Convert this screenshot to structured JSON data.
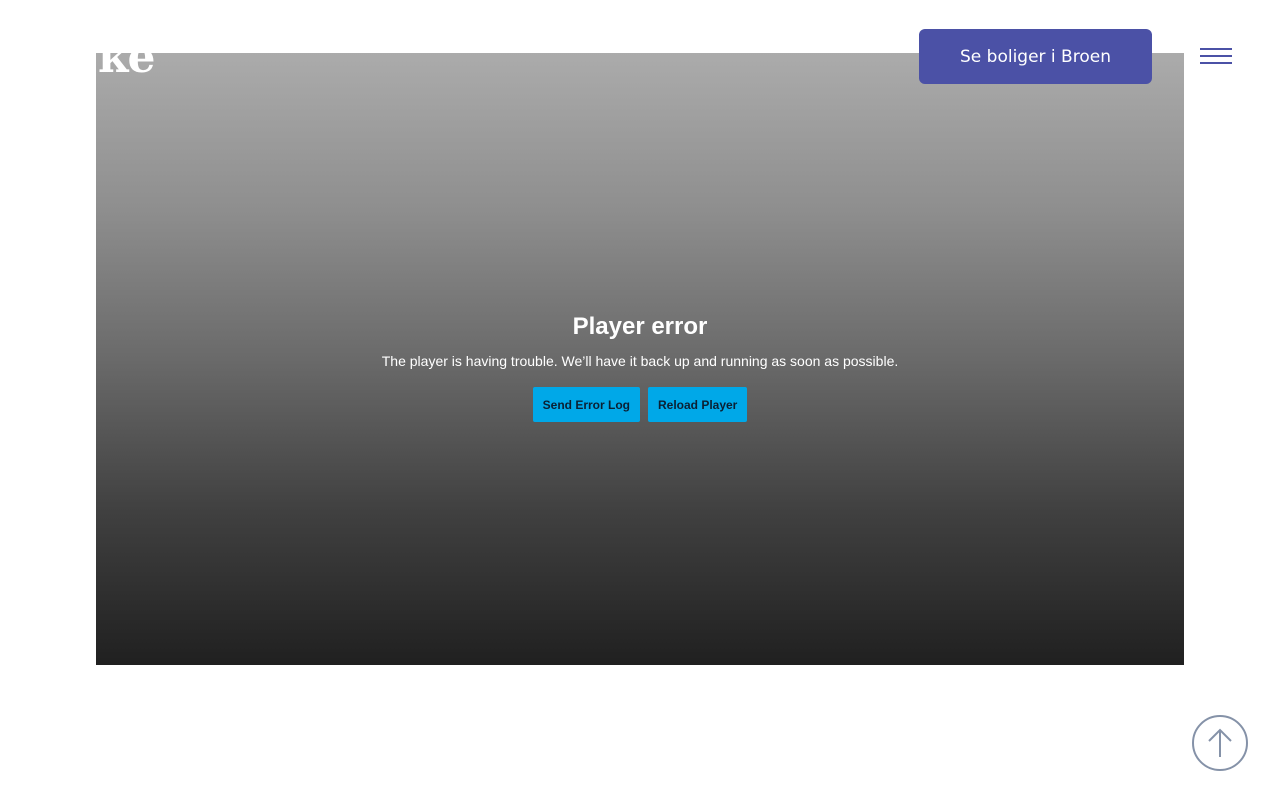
{
  "header": {
    "logo_text": "ke",
    "cta_label": "Se boliger i Broen",
    "menu_icon": "hamburger-menu-icon"
  },
  "player": {
    "error_title": "Player error",
    "error_message": "The player is having trouble. We’ll have it back up and running as soon as possible.",
    "send_log_label": "Send Error Log",
    "reload_label": "Reload Player"
  },
  "scroll_top": {
    "icon": "arrow-up-icon"
  },
  "colors": {
    "cta_bg": "#4b51a6",
    "error_button_bg": "#00a8e8",
    "scroll_top_border": "#8592a8"
  }
}
